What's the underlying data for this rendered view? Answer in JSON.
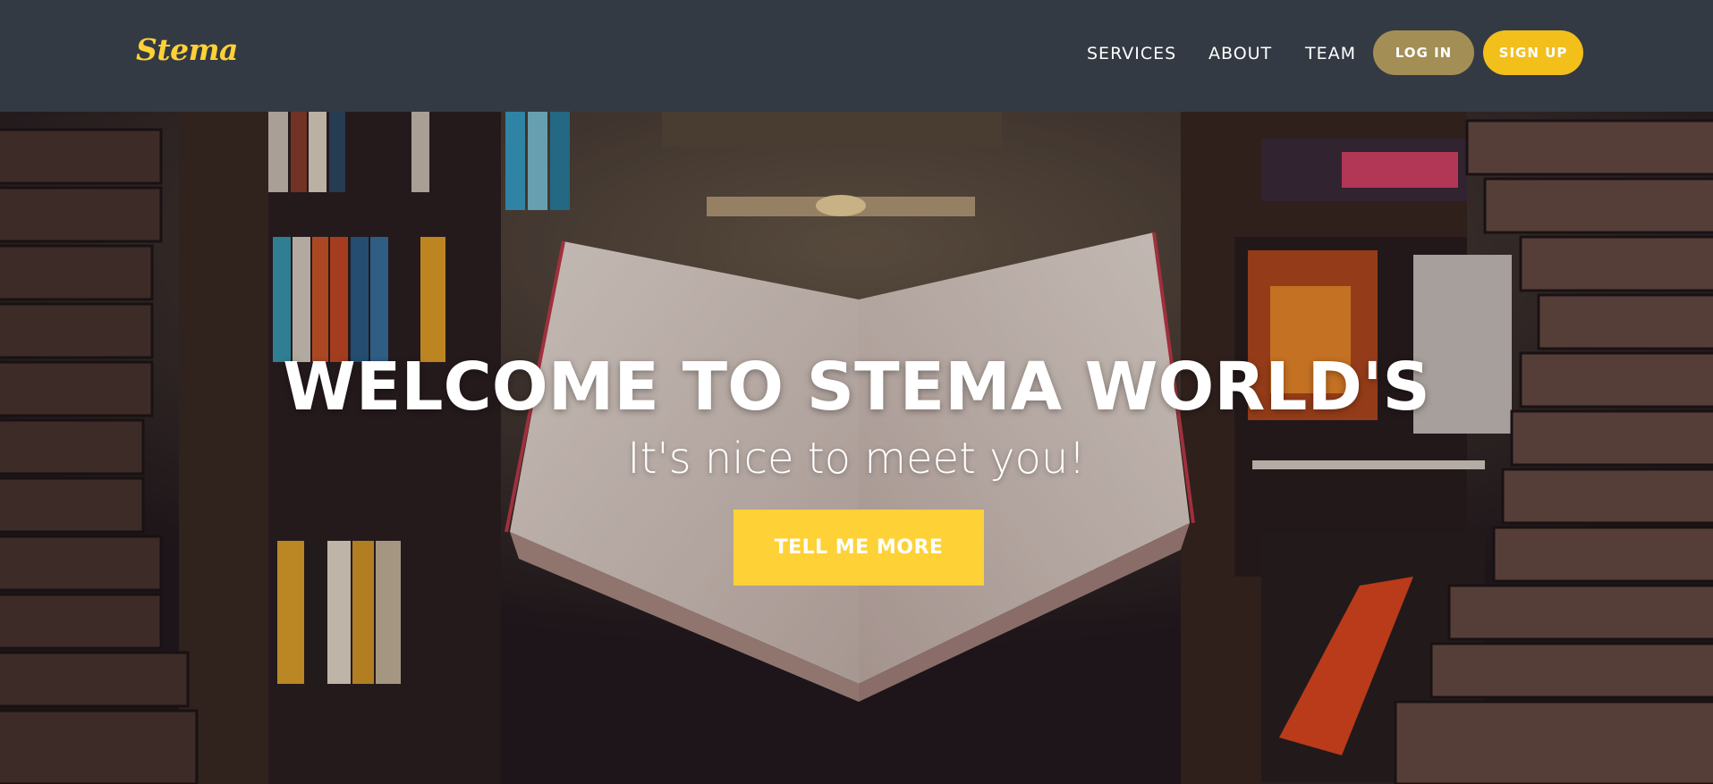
{
  "navbar": {
    "brand": "Stema",
    "links": {
      "services": "SERVICES",
      "about": "ABOUT",
      "team": "TEAM"
    },
    "login_label": "LOG IN",
    "signup_label": "SIGN UP"
  },
  "hero": {
    "title": "WELCOME TO STEMA WORLD'S",
    "subtitle": "It's nice to meet you!",
    "cta_label": "TELL ME MORE",
    "background_description_icon": "library-books-photo"
  },
  "colors": {
    "navbar_bg": "#343a44",
    "brand": "#fed136",
    "login_bg": "#a38f55",
    "signup_bg": "#f2bf1b",
    "cta_bg": "#fed136"
  }
}
